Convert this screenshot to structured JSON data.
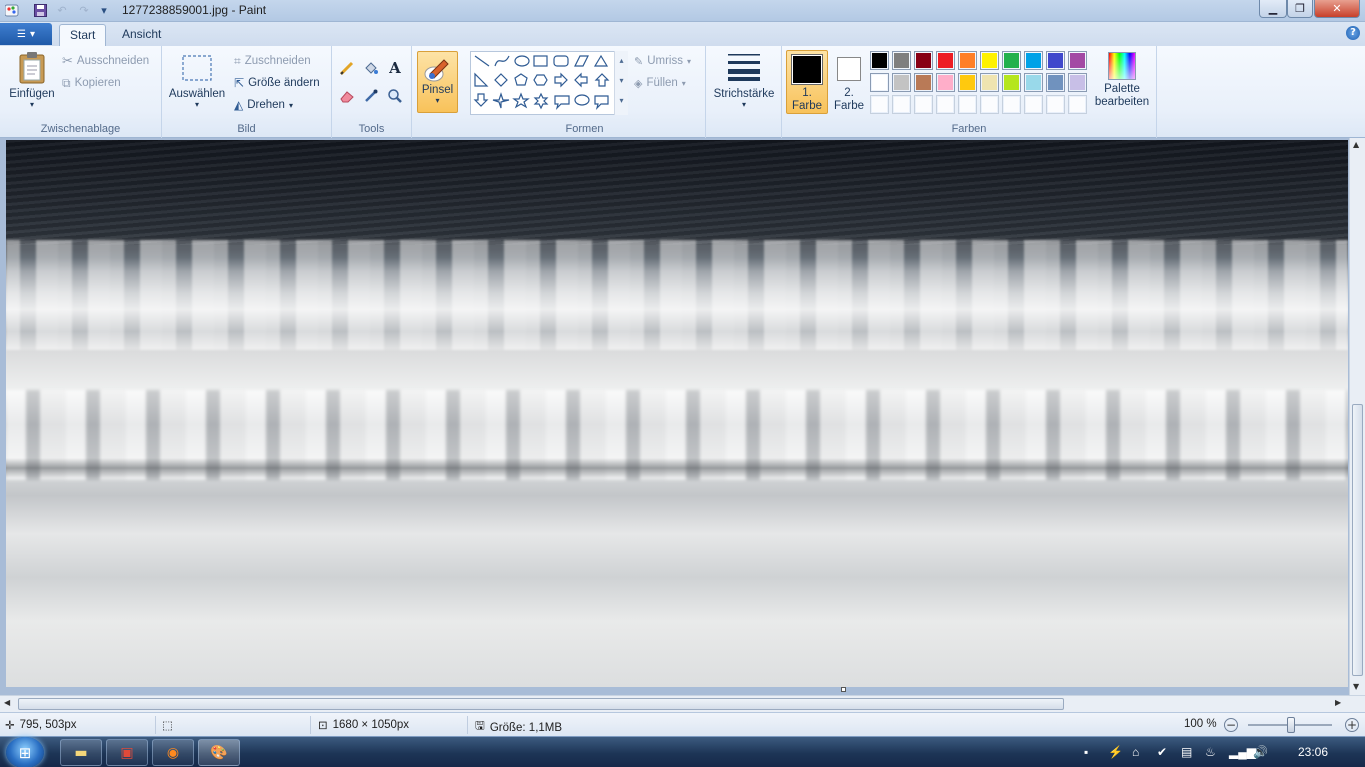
{
  "window": {
    "title": "1277238859001.jpg - Paint"
  },
  "tabs": [
    {
      "label": "Start"
    },
    {
      "label": "Ansicht"
    }
  ],
  "clipboard": {
    "paste": "Einfügen",
    "cut": "Ausschneiden",
    "copy": "Kopieren",
    "group": "Zwischenablage"
  },
  "image_group": {
    "select": "Auswählen",
    "crop": "Zuschneiden",
    "resize": "Größe ändern",
    "rotate": "Drehen",
    "group": "Bild"
  },
  "tools": {
    "group": "Tools",
    "text_glyph": "A"
  },
  "brush": {
    "label": "Pinsel"
  },
  "shapes": {
    "outline": "Umriss",
    "fill": "Füllen",
    "group": "Formen"
  },
  "stroke": {
    "label": "Strichstärke"
  },
  "colors": {
    "color1": "1. Farbe",
    "color2": "2. Farbe",
    "edit_palette": "Palette bearbeiten",
    "group": "Farben",
    "color1_value": "#000000",
    "color2_value": "#ffffff",
    "palette_row1": [
      "#000000",
      "#7f7f7f",
      "#880015",
      "#ed1c24",
      "#ff7f27",
      "#fff200",
      "#22b14c",
      "#00a2e8",
      "#3f48cc",
      "#a349a4"
    ],
    "palette_row2": [
      "#ffffff",
      "#c3c3c3",
      "#b97a57",
      "#ffaec9",
      "#ffc90e",
      "#efe4b0",
      "#b5e61d",
      "#99d9ea",
      "#7092be",
      "#c8bfe7"
    ]
  },
  "status": {
    "cursor": "795, 503px",
    "dimensions": "1680 × 1050px",
    "size": "Größe: 1,1MB",
    "zoom": "100 %"
  },
  "taskbar": {
    "clock": "23:06"
  }
}
